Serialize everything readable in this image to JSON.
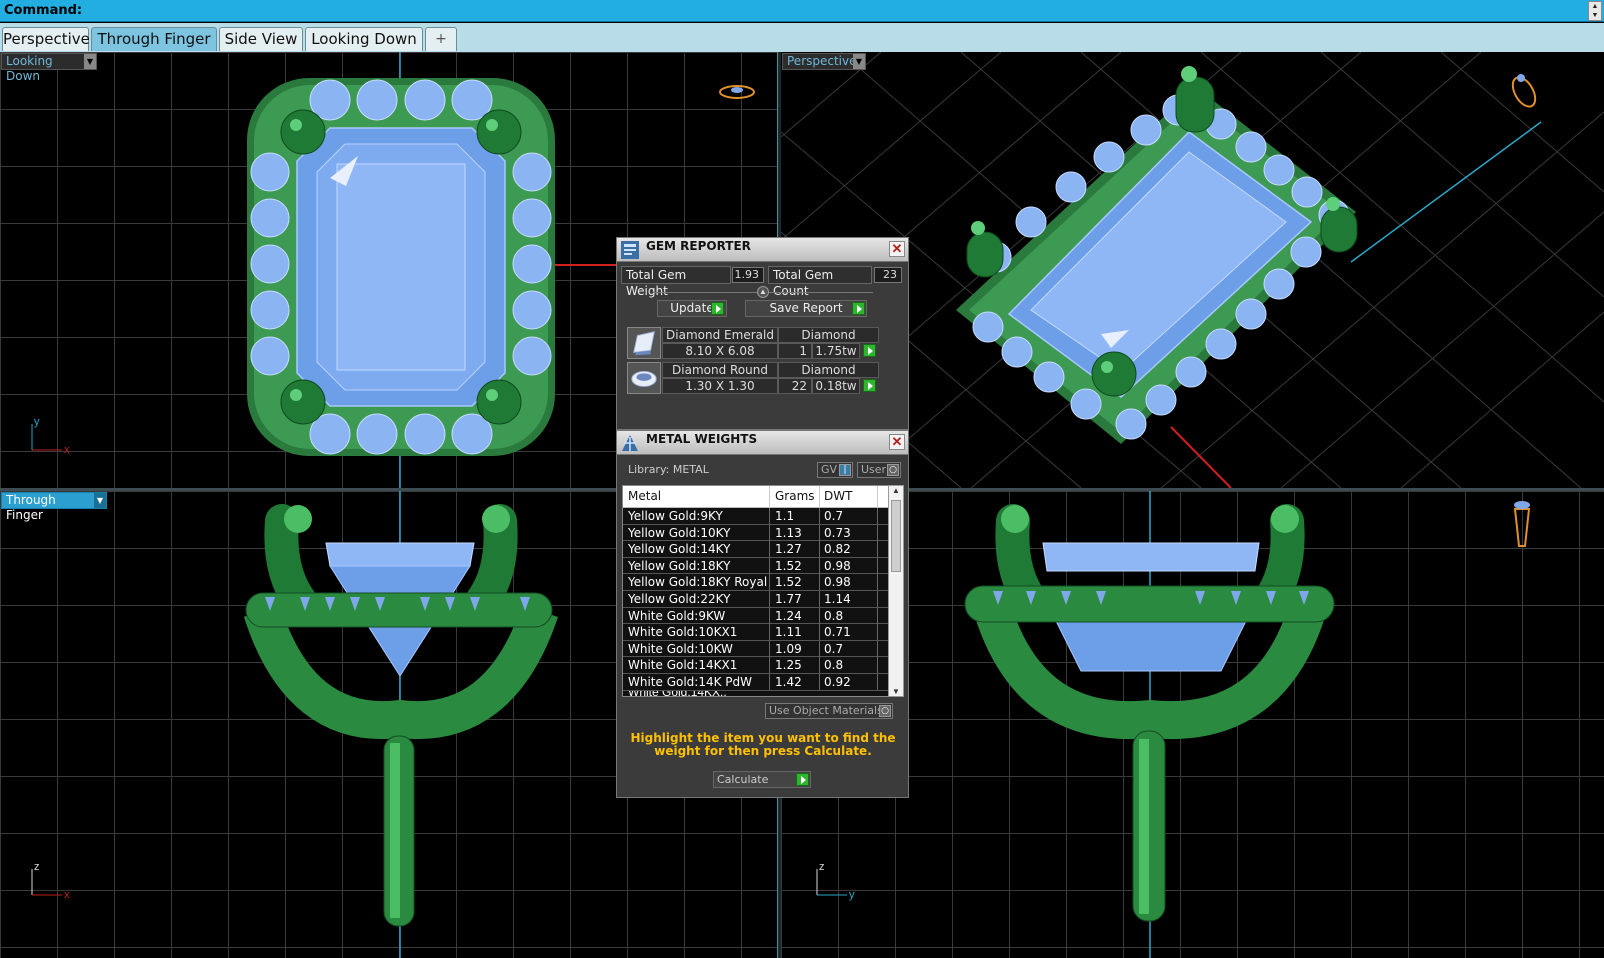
{
  "command": {
    "label": "Command:"
  },
  "tabs": [
    {
      "label": "Perspective",
      "active": false
    },
    {
      "label": "Through Finger",
      "active": true
    },
    {
      "label": "Side View",
      "active": false
    },
    {
      "label": "Looking Down",
      "active": false
    },
    {
      "label": "+",
      "active": false
    }
  ],
  "viewports": {
    "top_left": {
      "label": "Looking Down",
      "axes": [
        "y",
        "x"
      ]
    },
    "top_right": {
      "label": "Perspective"
    },
    "bottom_left": {
      "label": "Through Finger",
      "axes": [
        "z",
        "x"
      ]
    },
    "bottom_right": {
      "label": "",
      "axes": [
        "z",
        "y"
      ]
    }
  },
  "gem_reporter": {
    "title": "GEM REPORTER",
    "total_weight_label": "Total Gem Weight",
    "total_weight": "1.93",
    "total_count_label": "Total Gem Count",
    "total_count": "23",
    "update_label": "Update",
    "save_label": "Save Report",
    "gems": [
      {
        "name": "Diamond Emerald",
        "material": "Diamond",
        "size": "8.10 X 6.08",
        "count": "1",
        "weight": "1.75tw"
      },
      {
        "name": "Diamond Round",
        "material": "Diamond",
        "size": "1.30 X 1.30",
        "count": "22",
        "weight": "0.18tw"
      }
    ]
  },
  "metal_weights": {
    "title": "METAL WEIGHTS",
    "library": "Library: METAL",
    "gv_label": "GV",
    "user_label": "User",
    "columns": [
      "Metal",
      "Grams",
      "DWT"
    ],
    "rows": [
      {
        "metal": "Yellow Gold:9KY",
        "grams": "1.1",
        "dwt": "0.7"
      },
      {
        "metal": "Yellow Gold:10KY",
        "grams": "1.13",
        "dwt": "0.73"
      },
      {
        "metal": "Yellow Gold:14KY",
        "grams": "1.27",
        "dwt": "0.82"
      },
      {
        "metal": "Yellow Gold:18KY",
        "grams": "1.52",
        "dwt": "0.98"
      },
      {
        "metal": "Yellow Gold:18KY Royal",
        "grams": "1.52",
        "dwt": "0.98"
      },
      {
        "metal": "Yellow Gold:22KY",
        "grams": "1.77",
        "dwt": "1.14"
      },
      {
        "metal": "White Gold:9KW",
        "grams": "1.24",
        "dwt": "0.8"
      },
      {
        "metal": "White Gold:10KX1",
        "grams": "1.11",
        "dwt": "0.71"
      },
      {
        "metal": "White Gold:10KW",
        "grams": "1.09",
        "dwt": "0.7"
      },
      {
        "metal": "White Gold:14KX1",
        "grams": "1.25",
        "dwt": "0.8"
      },
      {
        "metal": "White Gold:14K PdW",
        "grams": "1.42",
        "dwt": "0.92"
      }
    ],
    "use_object_materials": "Use Object Materials",
    "hint": "Highlight the item you want to find the weight for then press Calculate.",
    "calculate_label": "Calculate"
  },
  "colors": {
    "accent": "#22aee0",
    "metal_green": "#2e8b45",
    "gem_blue": "#7fa8ea",
    "hint_yellow": "#ffc000"
  }
}
